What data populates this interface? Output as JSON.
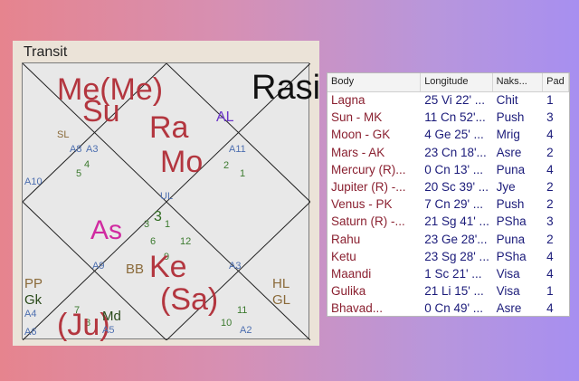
{
  "panel": {
    "title": "Transit",
    "label": "Rasi"
  },
  "chart": {
    "houses": [
      "1",
      "2",
      "3",
      "4",
      "5",
      "6",
      "7",
      "8",
      "9",
      "10",
      "11",
      "12"
    ],
    "planets_top": [
      "Me(Me)",
      "Su",
      "Ra",
      "Mo"
    ],
    "planets_center": [
      "As",
      "UL",
      "Ke",
      "(Sa)",
      "(Ju)",
      "BB"
    ],
    "left_labels": [
      "PP",
      "Gk",
      "A4",
      "A6",
      "A10"
    ],
    "right_labels": [
      "HL",
      "GL"
    ],
    "small_labels": [
      "SL",
      "A8",
      "A3",
      "AL",
      "A11",
      "A9",
      "A5",
      "A2",
      "Md"
    ]
  },
  "table": {
    "headers": [
      "Body",
      "Longitude",
      "Naks...",
      "Pad"
    ],
    "rows": [
      {
        "body": "Lagna",
        "longitude": "25 Vi 22' ...",
        "nakshatra": "Chit",
        "pada": "1"
      },
      {
        "body": "Sun - MK",
        "longitude": "11 Cn 52'...",
        "nakshatra": "Push",
        "pada": "3"
      },
      {
        "body": "Moon - GK",
        "longitude": "4 Ge 25' ...",
        "nakshatra": "Mrig",
        "pada": "4"
      },
      {
        "body": "Mars - AK",
        "longitude": "23 Cn 18'...",
        "nakshatra": "Asre",
        "pada": "2"
      },
      {
        "body": "Mercury (R)...",
        "longitude": "0 Cn 13' ...",
        "nakshatra": "Puna",
        "pada": "4"
      },
      {
        "body": "Jupiter (R) -...",
        "longitude": "20 Sc 39' ...",
        "nakshatra": "Jye",
        "pada": "2"
      },
      {
        "body": "Venus - PK",
        "longitude": "7 Cn 29' ...",
        "nakshatra": "Push",
        "pada": "2"
      },
      {
        "body": "Saturn (R) -...",
        "longitude": "21 Sg 41' ...",
        "nakshatra": "PSha",
        "pada": "3"
      },
      {
        "body": "Rahu",
        "longitude": "23 Ge 28'...",
        "nakshatra": "Puna",
        "pada": "2"
      },
      {
        "body": "Ketu",
        "longitude": "23 Sg 28' ...",
        "nakshatra": "PSha",
        "pada": "4"
      },
      {
        "body": "Maandi",
        "longitude": "1 Sc 21' ...",
        "nakshatra": "Visa",
        "pada": "4"
      },
      {
        "body": "Gulika",
        "longitude": "21 Li 15' ...",
        "nakshatra": "Visa",
        "pada": "1"
      },
      {
        "body": "Bhavad...",
        "longitude": "0 Cn 49' ...",
        "nakshatra": "Asre",
        "pada": "4"
      }
    ]
  }
}
